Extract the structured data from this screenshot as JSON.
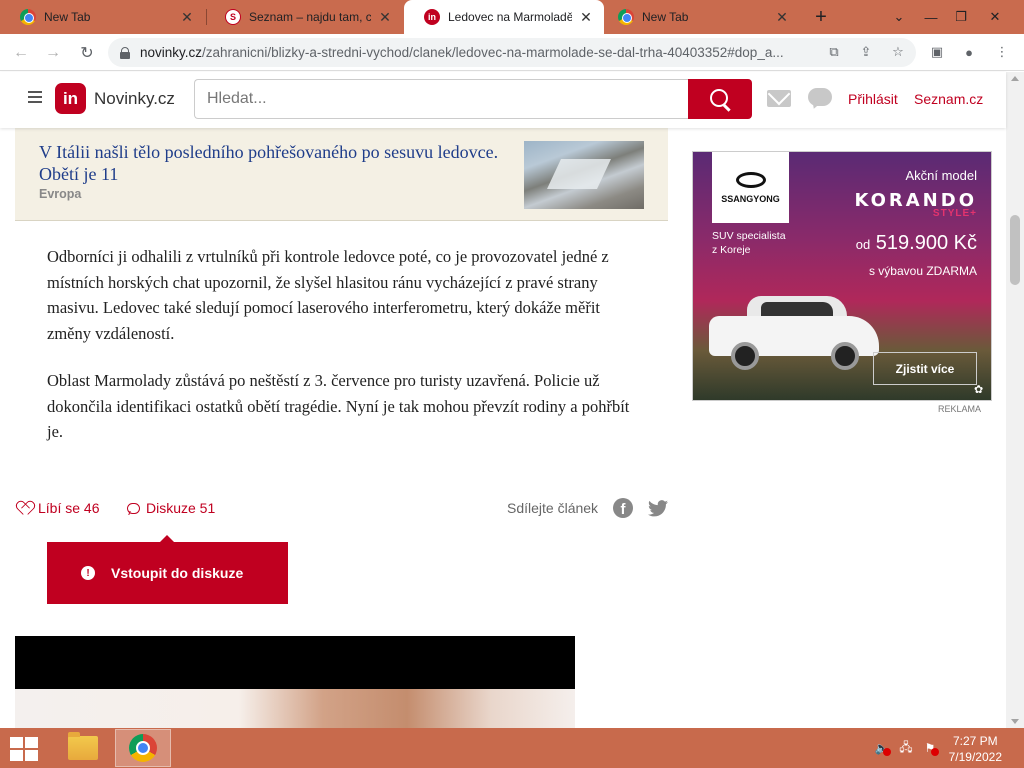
{
  "browser": {
    "tabs": [
      {
        "title": "New Tab",
        "icon": "chrome-icon",
        "active": false
      },
      {
        "title": "Seznam – najdu tam, co ne",
        "icon": "seznam-icon",
        "active": false
      },
      {
        "title": "Ledovec na Marmoladě se",
        "icon": "novinky-icon",
        "active": true
      },
      {
        "title": "New Tab",
        "icon": "chrome-icon",
        "active": false
      }
    ],
    "new_tab_symbol": "+",
    "url_host": "novinky.cz",
    "url_path": "/zahranicni/blizky-a-stredni-vychod/clanek/ledovec-na-marmolade-se-dal-trha-40403352#dop_a..."
  },
  "site_header": {
    "logo_badge": "in",
    "logo_text": "Novinky.cz",
    "search_placeholder": "Hledat...",
    "login_label": "Přihlásit",
    "seznam_label": "Seznam.cz"
  },
  "related_article": {
    "title": "V Itálii našli tělo posledního pohřešovaného po sesuvu ledovce. Obětí je 11",
    "category": "Evropa"
  },
  "article": {
    "paragraphs": [
      "Odborníci ji odhalili z vrtulníků při kontrole ledovce poté, co je provozovatel jedné z místních horských chat upozornil, že slyšel hlasitou ránu vycházející z pravé strany masivu. Ledovec také sledují pomocí laserového interferometru, který dokáže měřit změny vzdáleností.",
      "Oblast Marmolady zůstává po neštěstí z 3. července pro turisty uzavřená. Policie už dokončila identifikaci ostatků obětí tragédie. Nyní je tak mohou převzít rodiny a pohřbít je."
    ]
  },
  "actions": {
    "likes_label": "Líbí se 46",
    "discussion_label": "Diskuze 51",
    "share_label": "Sdílejte článek",
    "enter_discussion_label": "Vstoupit do diskuze"
  },
  "ad": {
    "brand_logo": "SSANGYONG",
    "subtitle_line1": "SUV specialista",
    "subtitle_line2": "z Koreje",
    "model_label": "Akční model",
    "model_name": "KORANDO",
    "model_style": "STYLE+",
    "price_prefix": "od",
    "price": "519.900 Kč",
    "extras": "s výbavou ZDARMA",
    "cta": "Zjistit více",
    "label": "REKLAMA"
  },
  "taskbar": {
    "time": "7:27 PM",
    "date": "7/19/2022"
  }
}
